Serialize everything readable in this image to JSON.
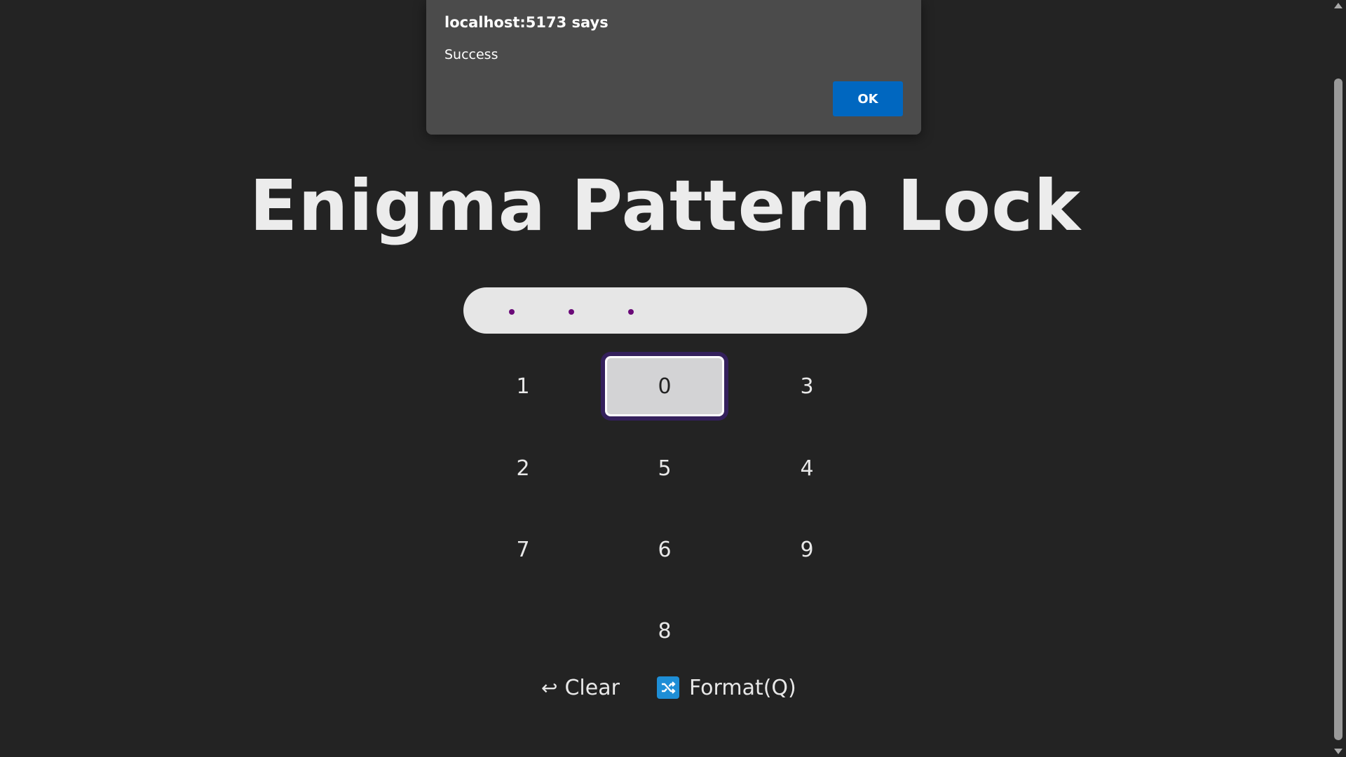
{
  "dialog": {
    "title": "localhost:5173 says",
    "message": "Success",
    "ok_label": "OK"
  },
  "app": {
    "title": "Enigma Pattern Lock"
  },
  "pattern": {
    "entered_dots": 3
  },
  "keypad": {
    "keys": [
      "1",
      "0",
      "3",
      "2",
      "5",
      "4",
      "7",
      "6",
      "9",
      "8"
    ],
    "focused_key": "0"
  },
  "controls": {
    "clear_icon": "↩",
    "clear_label": "Clear",
    "format_label": "Format(Q)",
    "format_icon": "shuffle-icon"
  },
  "colors": {
    "background": "#232323",
    "dot": "#6a0a78",
    "ok_button": "#0067c0",
    "focus_ring": "#34205c",
    "shuffle_icon_bg": "#1e8ed6"
  }
}
